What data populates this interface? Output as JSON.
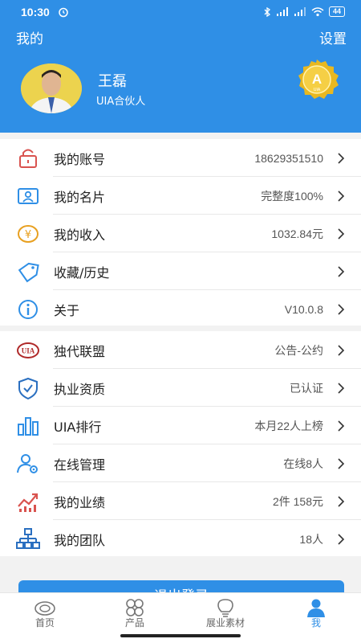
{
  "status_bar": {
    "time": "10:30",
    "battery": "44"
  },
  "header": {
    "title": "我的",
    "settings_label": "设置"
  },
  "profile": {
    "name": "王磊",
    "role": "UIA合伙人",
    "badge_text": "A",
    "badge_sub": "UIA"
  },
  "section1": [
    {
      "label": "我的账号",
      "value": "18629351510",
      "icon": "lock-icon"
    },
    {
      "label": "我的名片",
      "value": "完整度100%",
      "icon": "id-card-icon"
    },
    {
      "label": "我的收入",
      "value": "1032.84元",
      "icon": "yuan-coin-icon"
    },
    {
      "label": "收藏/历史",
      "value": "",
      "icon": "tag-icon"
    },
    {
      "label": "关于",
      "value": "V10.0.8",
      "icon": "info-icon"
    }
  ],
  "section2": [
    {
      "label": "独代联盟",
      "value": "公告-公约",
      "icon": "uia-logo-icon"
    },
    {
      "label": "执业资质",
      "value": "已认证",
      "icon": "shield-check-icon"
    },
    {
      "label": "UIA排行",
      "value": "本月22人上榜",
      "icon": "bar-chart-icon"
    },
    {
      "label": "在线管理",
      "value": "在线8人",
      "icon": "user-gear-icon"
    },
    {
      "label": "我的业绩",
      "value": "2件 158元",
      "icon": "trend-chart-icon"
    },
    {
      "label": "我的团队",
      "value": "18人",
      "icon": "org-chart-icon"
    }
  ],
  "logout_label": "退出登录",
  "tabs": [
    {
      "label": "首页",
      "icon": "home-logo-icon"
    },
    {
      "label": "产品",
      "icon": "grid-icon"
    },
    {
      "label": "展业素材",
      "icon": "bulb-icon"
    },
    {
      "label": "我",
      "icon": "person-icon"
    }
  ],
  "colors": {
    "brand": "#2f8fe6",
    "icon_red": "#d9534f",
    "icon_blue": "#2f8fe6",
    "badge_gold": "#e8b820"
  }
}
